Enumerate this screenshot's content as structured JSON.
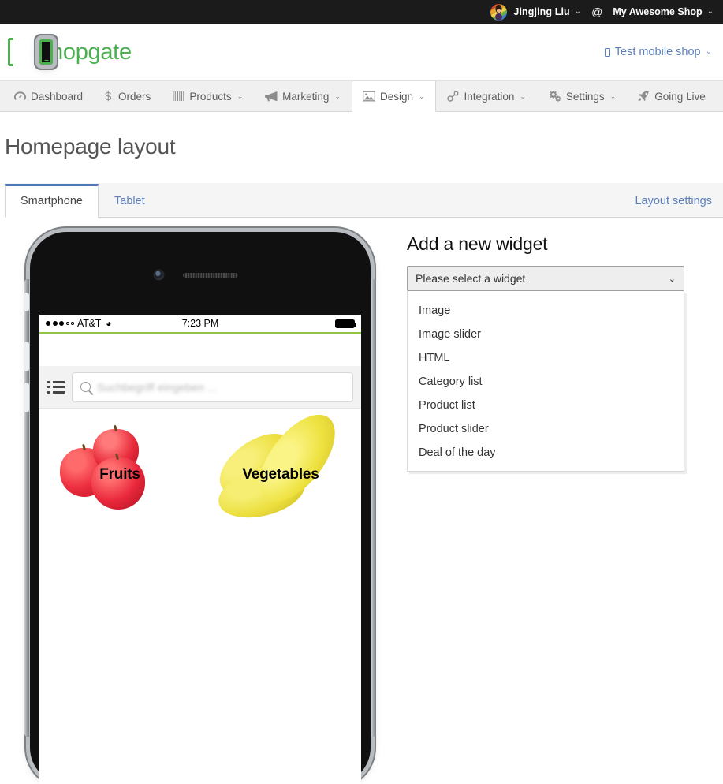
{
  "topbar": {
    "user_name": "Jingjing Liu",
    "separator": "@",
    "shop_name": "My Awesome Shop",
    "caret": "⌄"
  },
  "brand": {
    "name": "Shopgate",
    "test_shop_link": "Test mobile shop",
    "test_shop_caret": "⌄"
  },
  "nav": [
    {
      "label": "Dashboard",
      "icon": "dashboard-icon",
      "has_caret": false,
      "active": false
    },
    {
      "label": "Orders",
      "icon": "dollar-icon",
      "has_caret": false,
      "active": false
    },
    {
      "label": "Products",
      "icon": "barcode-icon",
      "has_caret": true,
      "active": false
    },
    {
      "label": "Marketing",
      "icon": "megaphone-icon",
      "has_caret": true,
      "active": false
    },
    {
      "label": "Design",
      "icon": "image-icon",
      "has_caret": true,
      "active": true
    },
    {
      "label": "Integration",
      "icon": "link-icon",
      "has_caret": true,
      "active": false
    },
    {
      "label": "Settings",
      "icon": "gears-icon",
      "has_caret": true,
      "active": false
    },
    {
      "label": "Going Live",
      "icon": "rocket-icon",
      "has_caret": false,
      "active": false
    }
  ],
  "page": {
    "title": "Homepage layout",
    "tabs": [
      {
        "label": "Smartphone",
        "active": true
      },
      {
        "label": "Tablet",
        "active": false
      }
    ],
    "layout_settings_link": "Layout settings"
  },
  "phone_preview": {
    "status_bar": {
      "signal_dots_filled": 3,
      "signal_dots_empty": 2,
      "carrier": "AT&T",
      "wifi_icon": "wifi-icon",
      "time": "7:23 PM",
      "battery_icon": "battery-full-icon"
    },
    "accent_color": "#8ec641",
    "search_placeholder": "Suchbegriff eingeben ...",
    "menu_icon": "list-menu-icon",
    "search_icon": "search-icon",
    "category_tiles": [
      {
        "label": "Fruits",
        "art": "red-apples"
      },
      {
        "label": "Vegetables",
        "art": "yellow-potatoes"
      }
    ]
  },
  "widget_picker": {
    "heading": "Add a new widget",
    "select_value": "Please select a widget",
    "select_caret": "⌄",
    "options": [
      "Image",
      "Image slider",
      "HTML",
      "Category list",
      "Product list",
      "Product slider",
      "Deal of the day"
    ]
  },
  "colors": {
    "brand_green": "#4caf50",
    "link_blue": "#5a7fbd",
    "active_tab_border": "#4a77b8",
    "topbar_bg": "#1b1b1b",
    "nav_bg": "#f0f0f0"
  }
}
